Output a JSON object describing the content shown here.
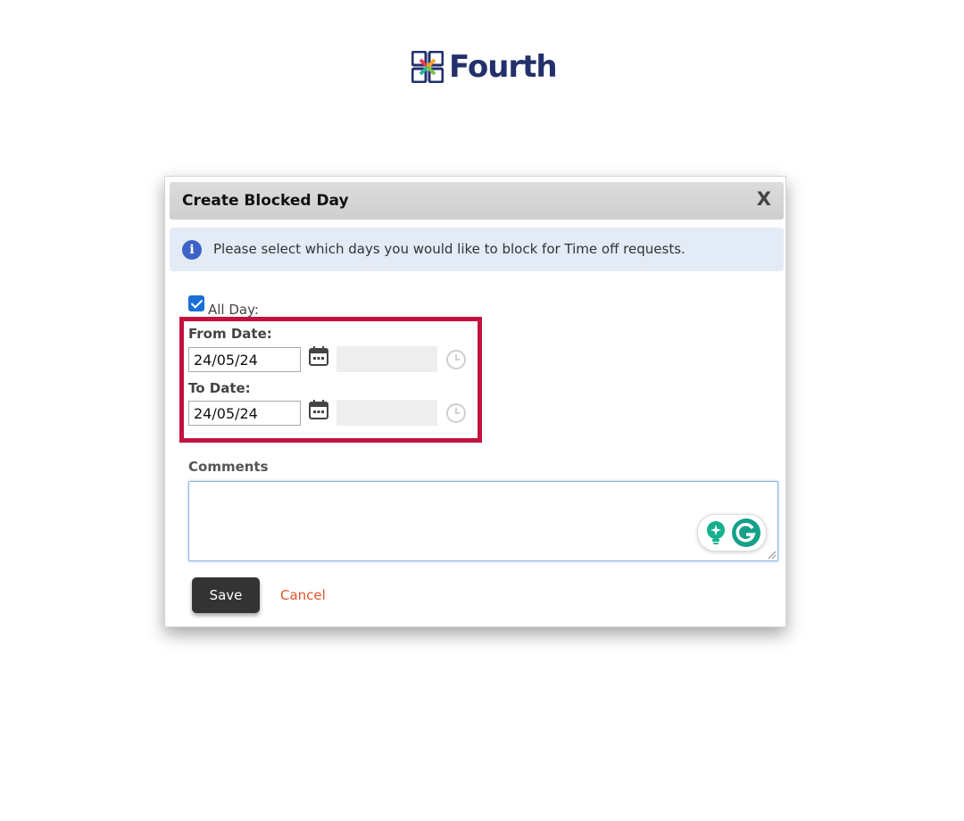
{
  "brand": {
    "name": "Fourth"
  },
  "dialog": {
    "title": "Create Blocked Day",
    "close_label": "X",
    "info_text": "Please select which days you would like to block for Time off requests.",
    "all_day": {
      "label": "All Day:",
      "checked": true
    },
    "from_date": {
      "label": "From Date:",
      "value": "24/05/24"
    },
    "to_date": {
      "label": "To Date:",
      "value": "24/05/24"
    },
    "comments": {
      "label": "Comments",
      "value": ""
    },
    "save_label": "Save",
    "cancel_label": "Cancel"
  },
  "colors": {
    "highlight": "#c2123f",
    "cancel": "#e0552b",
    "checkbox": "#1a6fd6",
    "brand_navy": "#23306b"
  }
}
